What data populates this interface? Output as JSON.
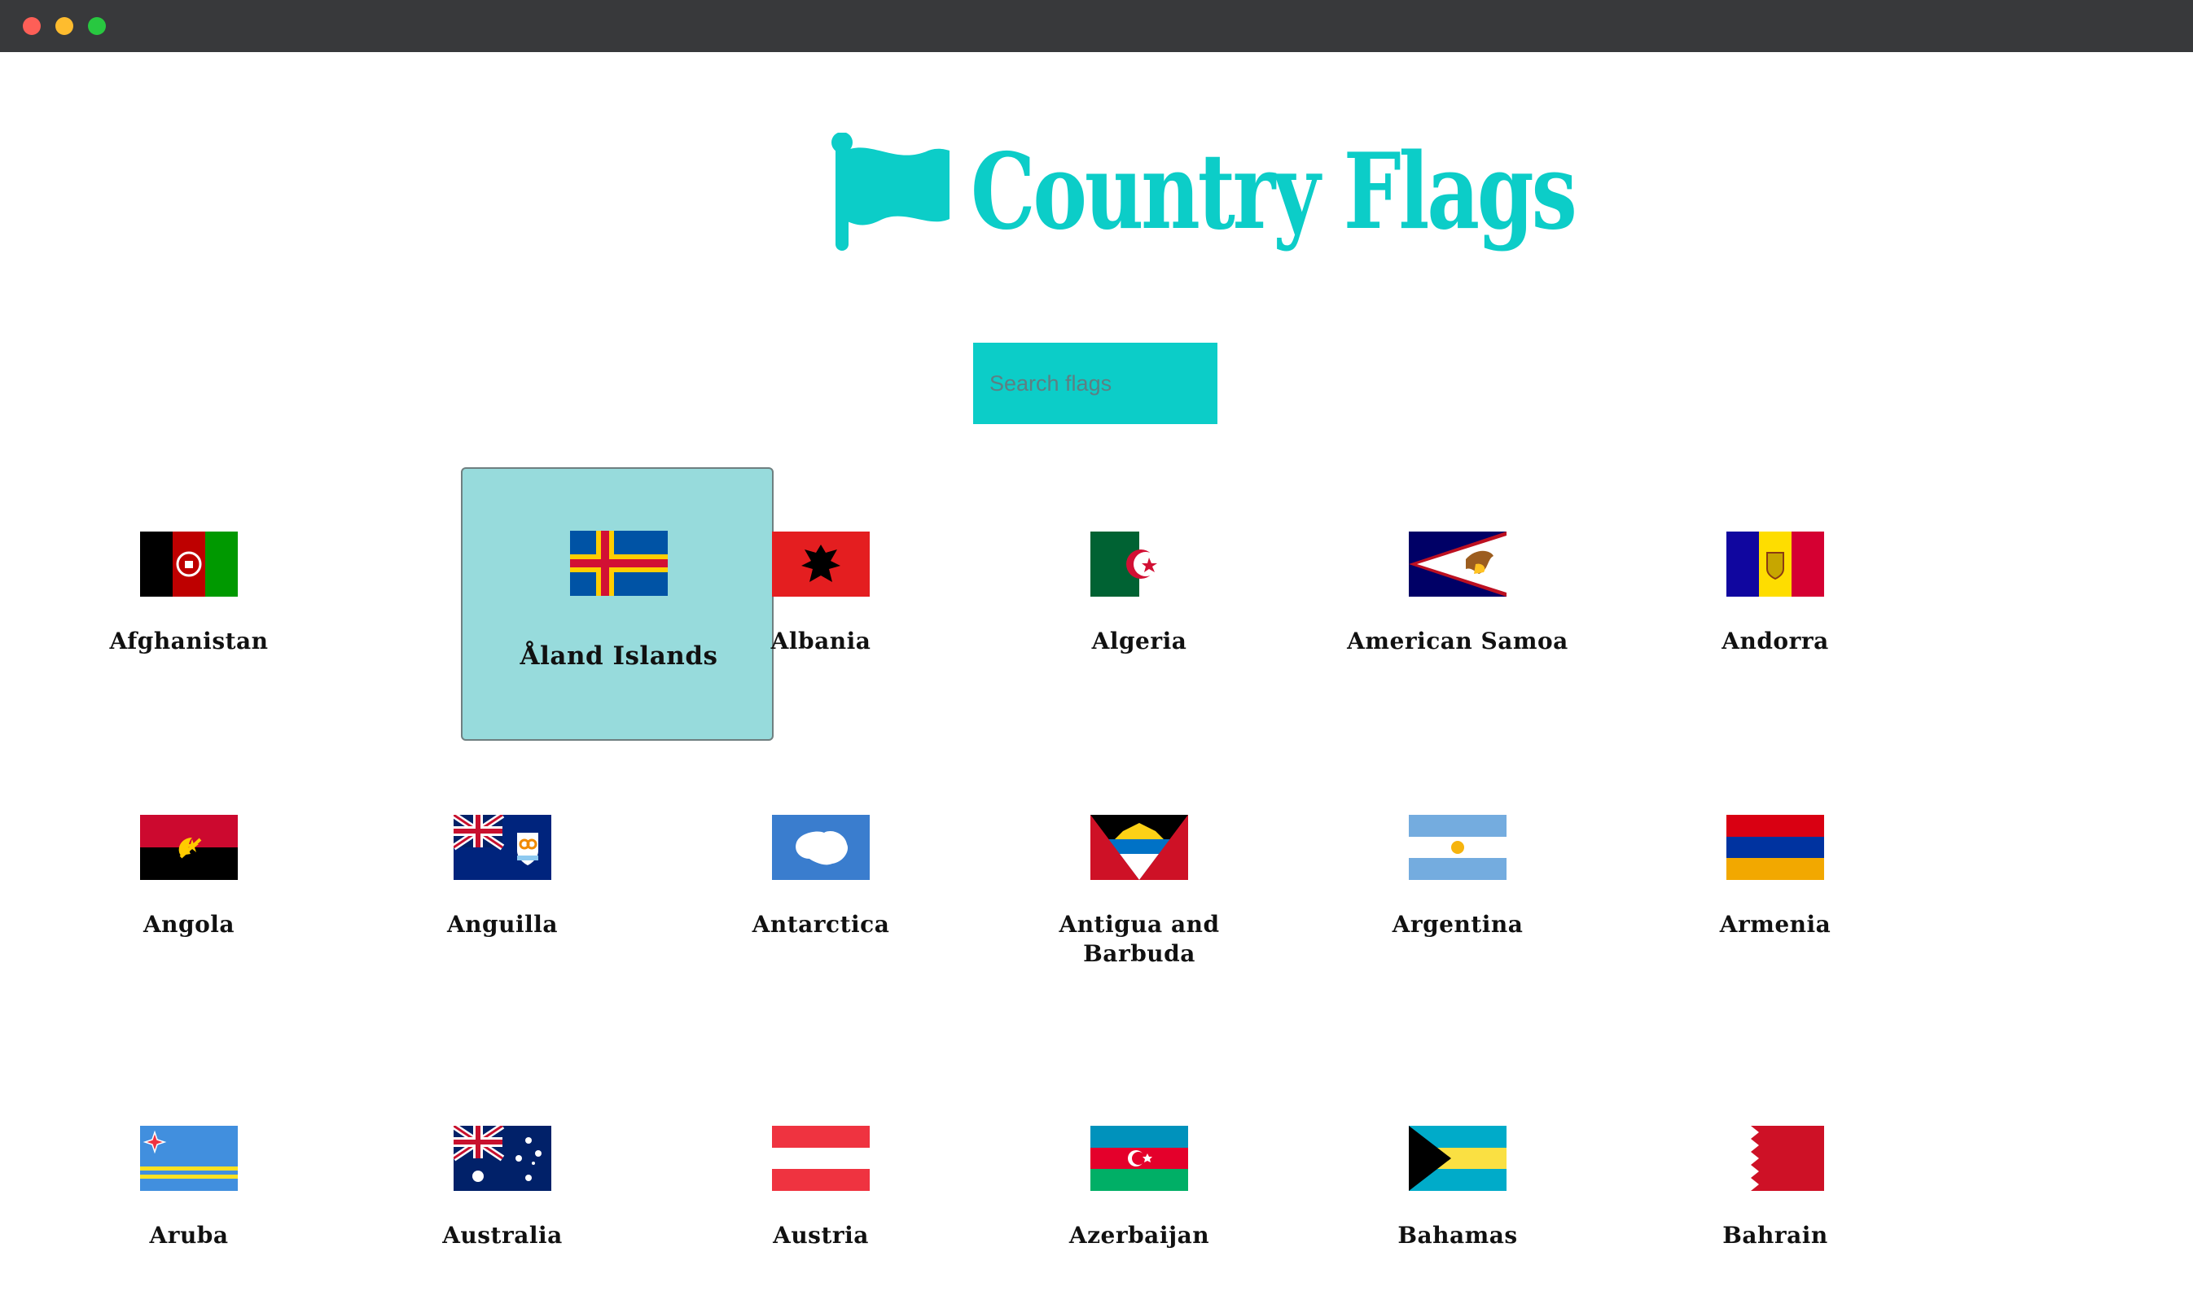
{
  "header": {
    "logo_text": "Country Flags",
    "logo_color": "#0ccdc8"
  },
  "search": {
    "placeholder": "Search flags",
    "value": ""
  },
  "countries": [
    {
      "name": "Afghanistan",
      "flag": "af"
    },
    {
      "name": "Åland Islands",
      "flag": "ax",
      "selected": true
    },
    {
      "name": "Albania",
      "flag": "al"
    },
    {
      "name": "Algeria",
      "flag": "dz"
    },
    {
      "name": "American Samoa",
      "flag": "as"
    },
    {
      "name": "Andorra",
      "flag": "ad"
    },
    {
      "name": "Angola",
      "flag": "ao"
    },
    {
      "name": "Anguilla",
      "flag": "ai"
    },
    {
      "name": "Antarctica",
      "flag": "aq"
    },
    {
      "name": "Antigua and Barbuda",
      "flag": "ag"
    },
    {
      "name": "Argentina",
      "flag": "ar"
    },
    {
      "name": "Armenia",
      "flag": "am"
    },
    {
      "name": "Aruba",
      "flag": "aw"
    },
    {
      "name": "Australia",
      "flag": "au"
    },
    {
      "name": "Austria",
      "flag": "at"
    },
    {
      "name": "Azerbaijan",
      "flag": "az"
    },
    {
      "name": "Bahamas",
      "flag": "bs"
    },
    {
      "name": "Bahrain",
      "flag": "bh"
    }
  ]
}
